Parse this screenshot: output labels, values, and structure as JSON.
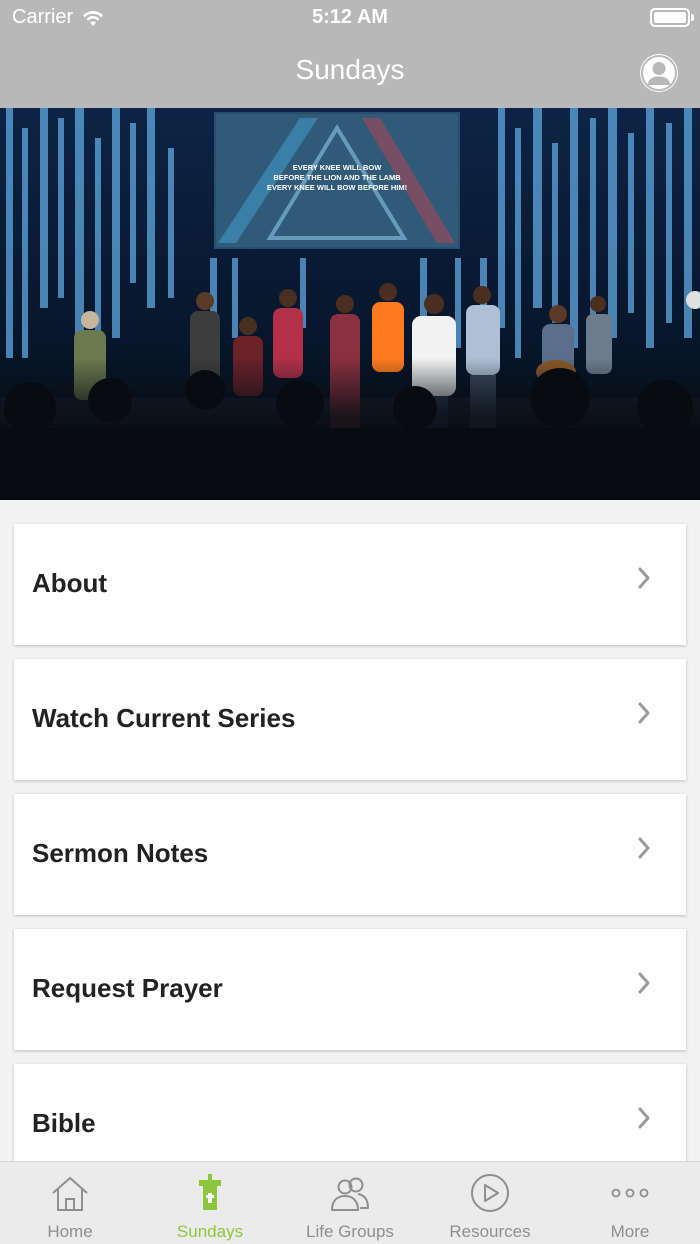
{
  "status_bar": {
    "carrier": "Carrier",
    "time": "5:12 AM"
  },
  "nav": {
    "title": "Sundays"
  },
  "hero": {
    "screen_lines": [
      "EVERY KNEE WILL BOW",
      "BEFORE THE LION AND THE LAMB",
      "EVERY KNEE WILL BOW BEFORE HIM!"
    ]
  },
  "menu": {
    "items": [
      {
        "label": "About"
      },
      {
        "label": "Watch Current Series"
      },
      {
        "label": "Sermon Notes"
      },
      {
        "label": "Request Prayer"
      },
      {
        "label": "Bible"
      }
    ]
  },
  "tabs": [
    {
      "label": "Home",
      "icon": "home-icon",
      "active": false
    },
    {
      "label": "Sundays",
      "icon": "church-icon",
      "active": true
    },
    {
      "label": "Life Groups",
      "icon": "people-icon",
      "active": false
    },
    {
      "label": "Resources",
      "icon": "play-icon",
      "active": false
    },
    {
      "label": "More",
      "icon": "more-icon",
      "active": false
    }
  ],
  "colors": {
    "accent": "#8cc63f",
    "bar_gray": "#b8b8b8",
    "tab_inactive": "#8e8e8e"
  }
}
